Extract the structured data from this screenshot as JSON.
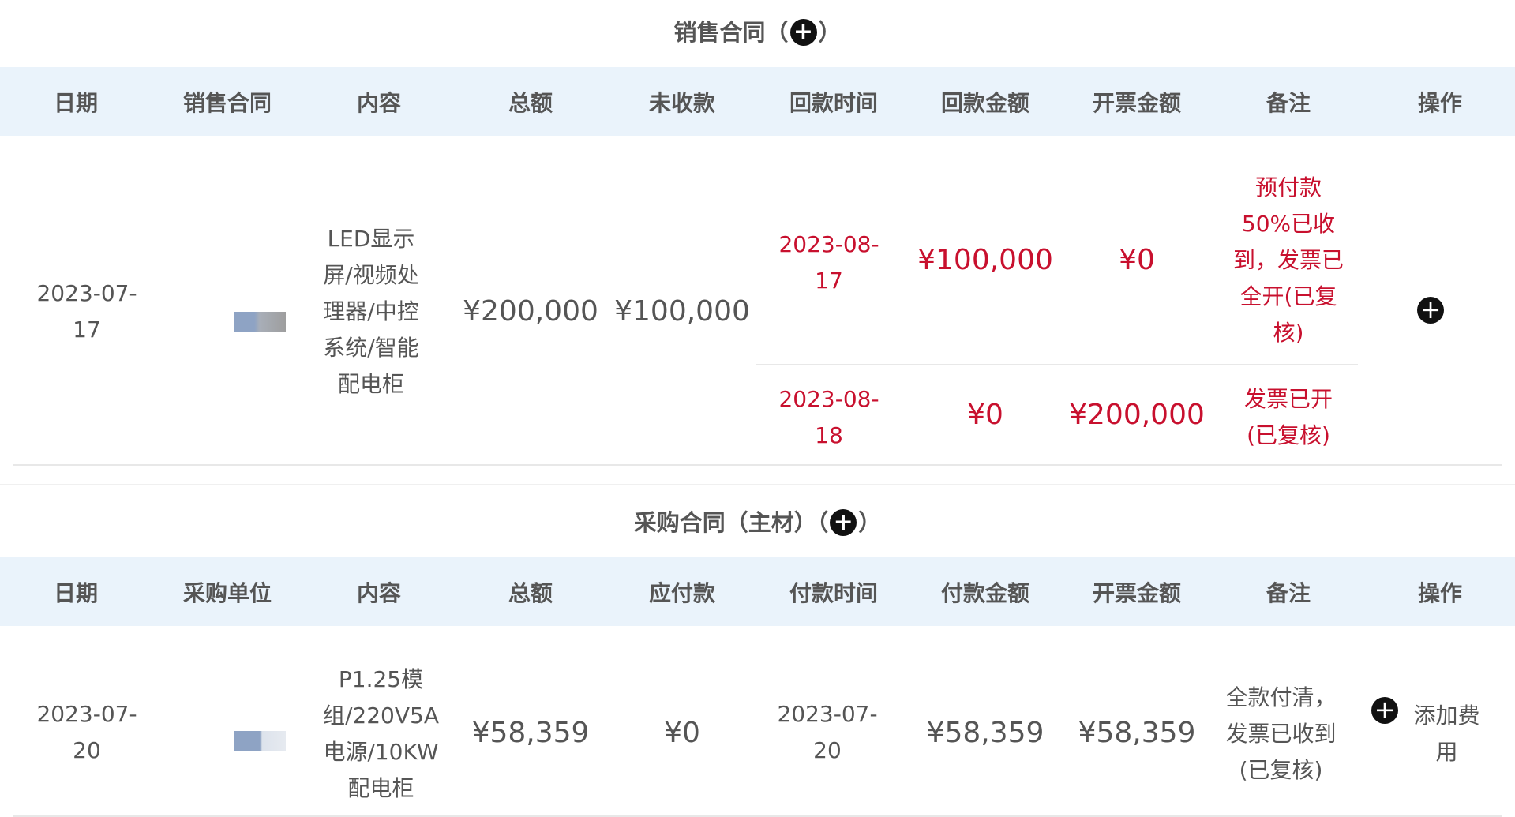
{
  "sales": {
    "title": "销售合同（",
    "title_close": "）",
    "headers": [
      "日期",
      "销售合同",
      "内容",
      "总额",
      "未收款",
      "回款时间",
      "回款金额",
      "开票金额",
      "备注",
      "操作"
    ],
    "row": {
      "date": "2023-07-17",
      "content": "LED显示屏/视频处理器/中控系统/智能配电柜",
      "total": "¥200,000",
      "unpaid": "¥100,000",
      "payments": [
        {
          "time": "2023-08-17",
          "amount": "¥100,000",
          "invoice": "¥0",
          "note": "预付款50%已收到，发票已全开(已复核)"
        },
        {
          "time": "2023-08-18",
          "amount": "¥0",
          "invoice": "¥200,000",
          "note": "发票已开(已复核)"
        }
      ]
    }
  },
  "purchase": {
    "title": "采购合同（主材）（",
    "title_close": "）",
    "headers": [
      "日期",
      "采购单位",
      "内容",
      "总额",
      "应付款",
      "付款时间",
      "付款金额",
      "开票金额",
      "备注",
      "操作"
    ],
    "row": {
      "date": "2023-07-20",
      "content": "P1.25模组/220V5A电源/10KW配电柜",
      "total": "¥58,359",
      "payable": "¥0",
      "pay_time": "2023-07-20",
      "pay_amount": "¥58,359",
      "invoice": "¥58,359",
      "note": "全款付清，发票已收到(已复核)",
      "action": "添加费用"
    }
  },
  "colors": {
    "accent_red": "#c8102e",
    "header_bg": "#eaf3fb"
  },
  "icons": {
    "add": "plus-circle-icon"
  }
}
